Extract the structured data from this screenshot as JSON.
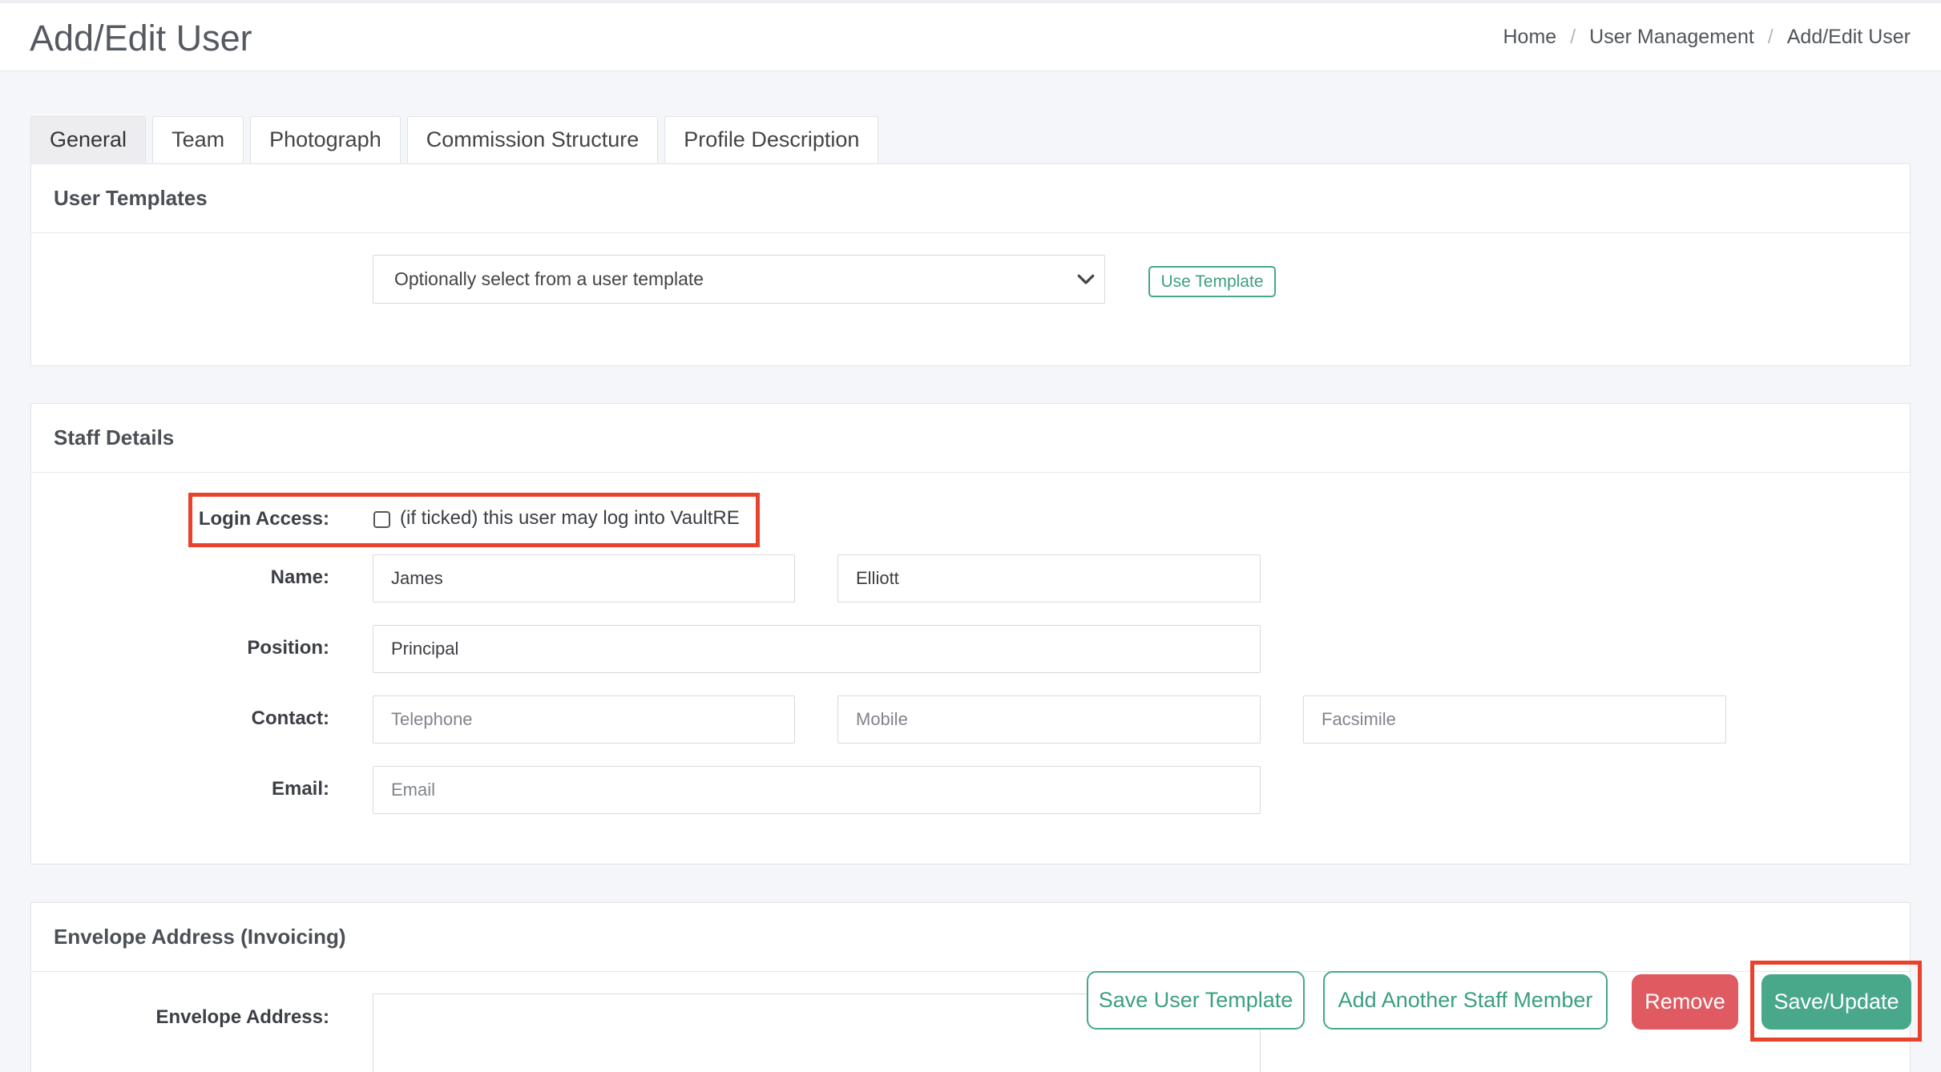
{
  "header": {
    "title": "Add/Edit User",
    "breadcrumb": [
      "Home",
      "User Management",
      "Add/Edit User"
    ],
    "separator": "/"
  },
  "tabs": [
    {
      "label": "General",
      "active": true
    },
    {
      "label": "Team",
      "active": false
    },
    {
      "label": "Photograph",
      "active": false
    },
    {
      "label": "Commission Structure",
      "active": false
    },
    {
      "label": "Profile Description",
      "active": false
    }
  ],
  "user_templates": {
    "heading": "User Templates",
    "select_value": "Optionally select from a user template",
    "use_template_label": "Use Template"
  },
  "staff_details": {
    "heading": "Staff Details",
    "login_access_label": "Login Access:",
    "login_access_checked": false,
    "login_access_text": "(if ticked) this user may log into VaultRE",
    "name_label": "Name:",
    "first_name": "James",
    "last_name": "Elliott",
    "position_label": "Position:",
    "position": "Principal",
    "contact_label": "Contact:",
    "telephone_placeholder": "Telephone",
    "mobile_placeholder": "Mobile",
    "facsimile_placeholder": "Facsimile",
    "email_label": "Email:",
    "email_placeholder": "Email"
  },
  "envelope": {
    "heading": "Envelope Address (Invoicing)",
    "address_label": "Envelope Address:"
  },
  "actions": {
    "save_template": "Save User Template",
    "add_staff": "Add Another Staff Member",
    "remove": "Remove",
    "save_update": "Save/Update"
  },
  "colors": {
    "accent": "#47a889",
    "danger": "#df5a61",
    "highlight": "#e8412c"
  }
}
